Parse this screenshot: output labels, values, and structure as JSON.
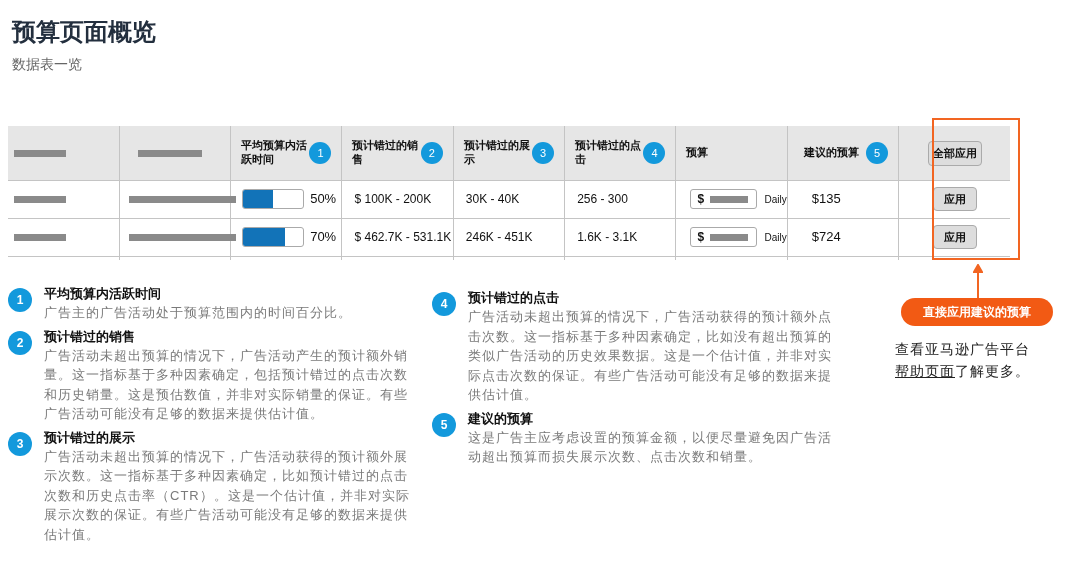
{
  "title": "预算页面概览",
  "subtitle": "数据表一览",
  "table": {
    "columns": [
      {
        "label": "平均预算内活跃时间",
        "badge": "1"
      },
      {
        "label": "预计错过的销售",
        "badge": "2"
      },
      {
        "label": "预计错过的展示",
        "badge": "3"
      },
      {
        "label": "预计错过的点击",
        "badge": "4"
      },
      {
        "label": "预算"
      },
      {
        "label": "建议的预算",
        "badge": "5"
      }
    ],
    "apply_all_button": "全部应用",
    "rows": [
      {
        "active_time": {
          "level": 0.5,
          "reading": "50%"
        },
        "missed_sales": "$ 100K - 200K",
        "missed_impressions": "30K - 40K",
        "missed_clicks": "256 - 300",
        "budget": {
          "currency": "$",
          "period": "Daily"
        },
        "suggested_budget": "$135",
        "apply_button": "应用"
      },
      {
        "active_time": {
          "level": 0.7,
          "reading": "70%"
        },
        "missed_sales": "$ 462.7K - 531.1K",
        "missed_impressions": "246K - 451K",
        "missed_clicks": "1.6K - 3.1K",
        "budget": {
          "currency": "$",
          "period": "Daily"
        },
        "suggested_budget": "$724",
        "apply_button": "应用"
      }
    ]
  },
  "notes_column_1": [
    {
      "badge": "1",
      "title": "平均预算内活跃时间",
      "text": "广告主的广告活动处于预算范围内的时间百分比。"
    },
    {
      "badge": "2",
      "title": "预计错过的销售",
      "text": "广告活动未超出预算的情况下，广告活动产生的预计额外销量。这一指标基于多种因素确定，包括预计错过的点击次数和历史销量。这是预估数值，并非对实际销量的保证。有些广告活动可能没有足够的数据来提供估计值。"
    },
    {
      "badge": "3",
      "title": "预计错过的展示",
      "text": "广告活动未超出预算的情况下，广告活动获得的预计额外展示次数。这一指标基于多种因素确定，比如预计错过的点击次数和历史点击率（CTR）。这是一个估计值，并非对实际展示次数的保证。有些广告活动可能没有足够的数据来提供估计值。"
    }
  ],
  "notes_column_2": [
    {
      "badge": "4",
      "title": "预计错过的点击",
      "text": "广告活动未超出预算的情况下，广告活动获得的预计额外点击次数。这一指标基于多种因素确定，比如没有超出预算的类似广告活动的历史效果数据。这是一个估计值，并非对实际点击次数的保证。有些广告活动可能没有足够的数据来提供估计值。"
    },
    {
      "badge": "5",
      "title": "建议的预算",
      "text": "这是广告主应考虑设置的预算金额，以便尽量避免因广告活动超出预算而损失展示次数、点击次数和销量。"
    }
  ],
  "callout": "直接应用建议的预算",
  "help": {
    "before": "查看亚马逊广告平台",
    "link": "帮助页面",
    "after": "了解更多。"
  }
}
